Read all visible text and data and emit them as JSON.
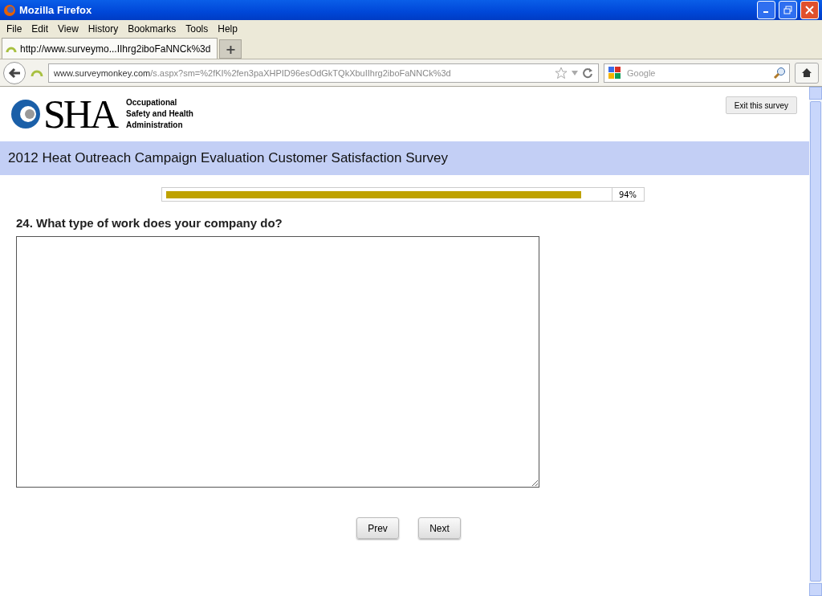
{
  "window": {
    "title": "Mozilla Firefox"
  },
  "menu": [
    "File",
    "Edit",
    "View",
    "History",
    "Bookmarks",
    "Tools",
    "Help"
  ],
  "tabs": [
    {
      "label": "http://www.surveymo...IIhrg2iboFaNNCk%3d",
      "selected": true
    }
  ],
  "new_tab": "+",
  "address": {
    "host": "www.surveymonkey.com",
    "path": "/s.aspx?sm=%2fKI%2fen3paXHPID96esOdGkTQkXbuIIhrg2iboFaNNCk%3d"
  },
  "search": {
    "placeholder": "Google"
  },
  "logo": {
    "letters": "SHA",
    "name_lines": [
      "Occupational",
      "Safety and Health",
      "Administration"
    ]
  },
  "exit_button": "Exit this survey",
  "survey_title": "2012 Heat Outreach Campaign Evaluation Customer Satisfaction Survey",
  "progress": {
    "level": 0.94,
    "reading": "94%"
  },
  "question": "24. What type of work does your company do?",
  "buttons": [
    "Prev",
    "Next"
  ]
}
